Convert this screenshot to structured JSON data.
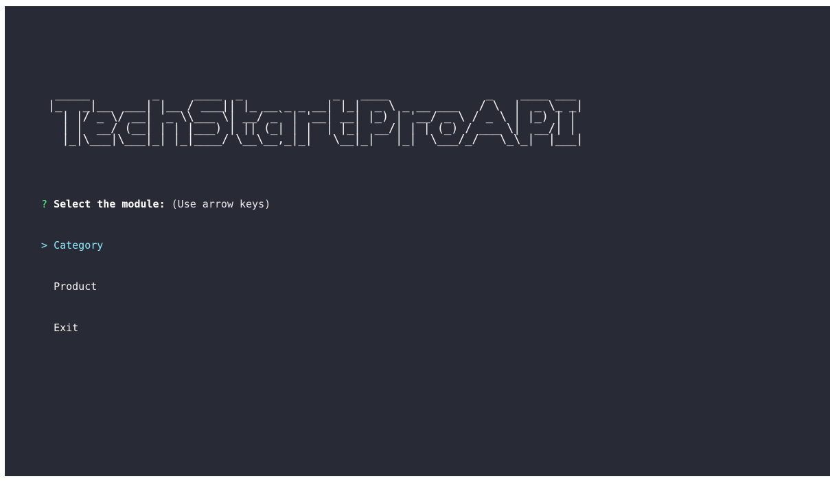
{
  "banner": {
    "text": "TechStartPro API",
    "ascii_art": " _____         _     ____  _             _   ____              _    ____ ___ \n|_   _|__  ___| |__ / ___|| |_ __ _ _ __| |_|  _ \\ _ __ ___   / \\  |  _ \\_ _|\n  | |/ _ \\/ __| '_ \\\\___ \\| __/ _` | '__| __| |_) | '__/ _ \\ / _ \\ | |_) | | \n  | |  __/ (__| | | |___) | || (_| | |  | |_|  __/| | | (_) / ___ \\|  __/| | \n  |_|\\___|\\___|_| |_|____/ \\__\\__,_|_|   \\__|_|   |_|  \\___/_/   \\_\\_|  |___|"
  },
  "prompt": {
    "question_mark": "?",
    "question": "Select the module:",
    "hint": "(Use arrow keys)"
  },
  "menu": {
    "pointer": ">",
    "options": [
      {
        "label": "Category",
        "selected": true
      },
      {
        "label": "Product",
        "selected": false
      },
      {
        "label": "Exit",
        "selected": false
      }
    ]
  },
  "colors": {
    "background": "#282a36",
    "question_mark": "#50fa7b",
    "selected": "#8be9fd",
    "text": "#f8f8f2"
  }
}
